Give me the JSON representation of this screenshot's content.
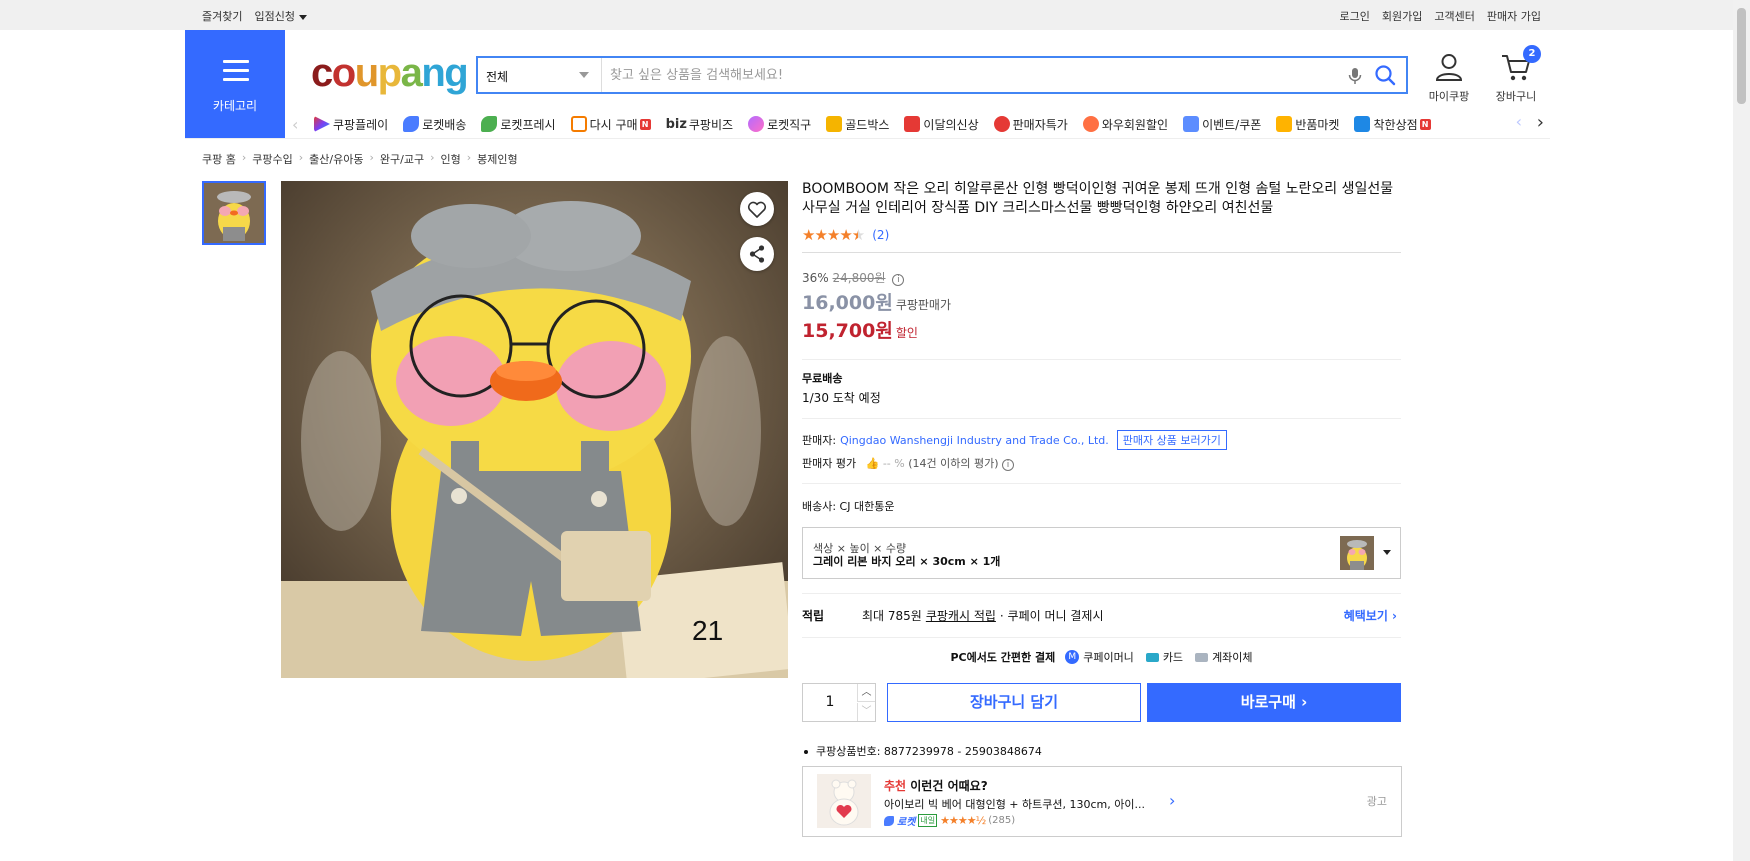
{
  "topbar": {
    "bookmark": "즐겨찾기",
    "store_apply": "입점신청",
    "login": "로그인",
    "signup": "회원가입",
    "customer_center": "고객센터",
    "seller_signup": "판매자 가입"
  },
  "header": {
    "category_label": "카테고리",
    "logo": {
      "c": "c",
      "o1": "o",
      "u": "u",
      "p": "p",
      "a": "a",
      "n": "n",
      "g": "g"
    },
    "search_select": "전체",
    "search_placeholder": "찾고 싶은 상품을 검색해보세요!",
    "mycoupang": "마이쿠팡",
    "cart_label": "장바구니",
    "cart_count": "2"
  },
  "shortcuts": [
    "쿠팡플레이",
    "로켓배송",
    "로켓프레시",
    "다시 구매",
    "쿠팡비즈",
    "로켓직구",
    "골드박스",
    "이달의신상",
    "판매자특가",
    "와우회원할인",
    "이벤트/쿠폰",
    "반품마켓",
    "착한상점"
  ],
  "shortcut_biz_prefix": "biz",
  "shortcut_new_badge": "N",
  "breadcrumb": [
    "쿠팡 홈",
    "쿠팡수입",
    "출산/유아동",
    "완구/교구",
    "인형",
    "봉제인형"
  ],
  "gallery": {
    "image_index_label": "21"
  },
  "product": {
    "title": "BOOMBOOM 작은 오리 히알루론산 인형 빵덕이인형 귀여운 봉제 뜨개 인형 솜털 노란오리 생일선물 사무실 거실 인테리어 장식품 DIY 크리스마스선물 빵빵덕인형 하얀오리 여친선물",
    "rating": 4.5,
    "review_count": "(2)",
    "discount_rate": "36%",
    "original_price": "24,800원",
    "sale_price": "16,000원",
    "sale_price_label": "쿠팡판매가",
    "final_price": "15,700원",
    "final_price_label": "할인",
    "shipping_title": "무료배송",
    "arrival": "1/30 도착 예정",
    "seller_label": "판매자:",
    "seller_name": "Qingdao Wanshengji Industry and Trade Co., Ltd.",
    "seller_products_btn": "판매자 상품 보러가기",
    "seller_rating_label": "판매자 평가",
    "seller_rating_value": "-- %",
    "seller_rating_note": "(14건 이하의 평가)",
    "courier": "배송사:  CJ 대한통운",
    "option_header": "색상 × 높이 × 수량",
    "option_value": "그레이 리본 바지 오리 × 30cm × 1개",
    "points_label": "적립",
    "points_text": "최대 785원",
    "points_link": "쿠팡캐시 적립",
    "points_suffix": "· 쿠페이 머니 결제시",
    "benefit_link": "혜택보기",
    "pc_pay_label": "PC에서도 간편한 결제",
    "pay_methods": [
      "쿠페이머니",
      "카드",
      "계좌이체"
    ],
    "quantity": "1",
    "add_to_cart": "장바구니 담기",
    "buy_now": "바로구매",
    "product_no": "쿠팡상품번호: 8877239978 - 25903848674"
  },
  "recommend": {
    "title_accent": "추천",
    "title_rest": " 이런건 어때요?",
    "item_name": "아이보리 빅 베어 대형인형 + 하트쿠션, 130cm, 아이...",
    "rocket_label": "로켓",
    "tomorrow_label": "내일",
    "review_count": "(285)",
    "ad_label": "광고"
  },
  "colors": {
    "accent": "#346aff",
    "price_red": "#c0232f",
    "star": "#f4802a"
  }
}
